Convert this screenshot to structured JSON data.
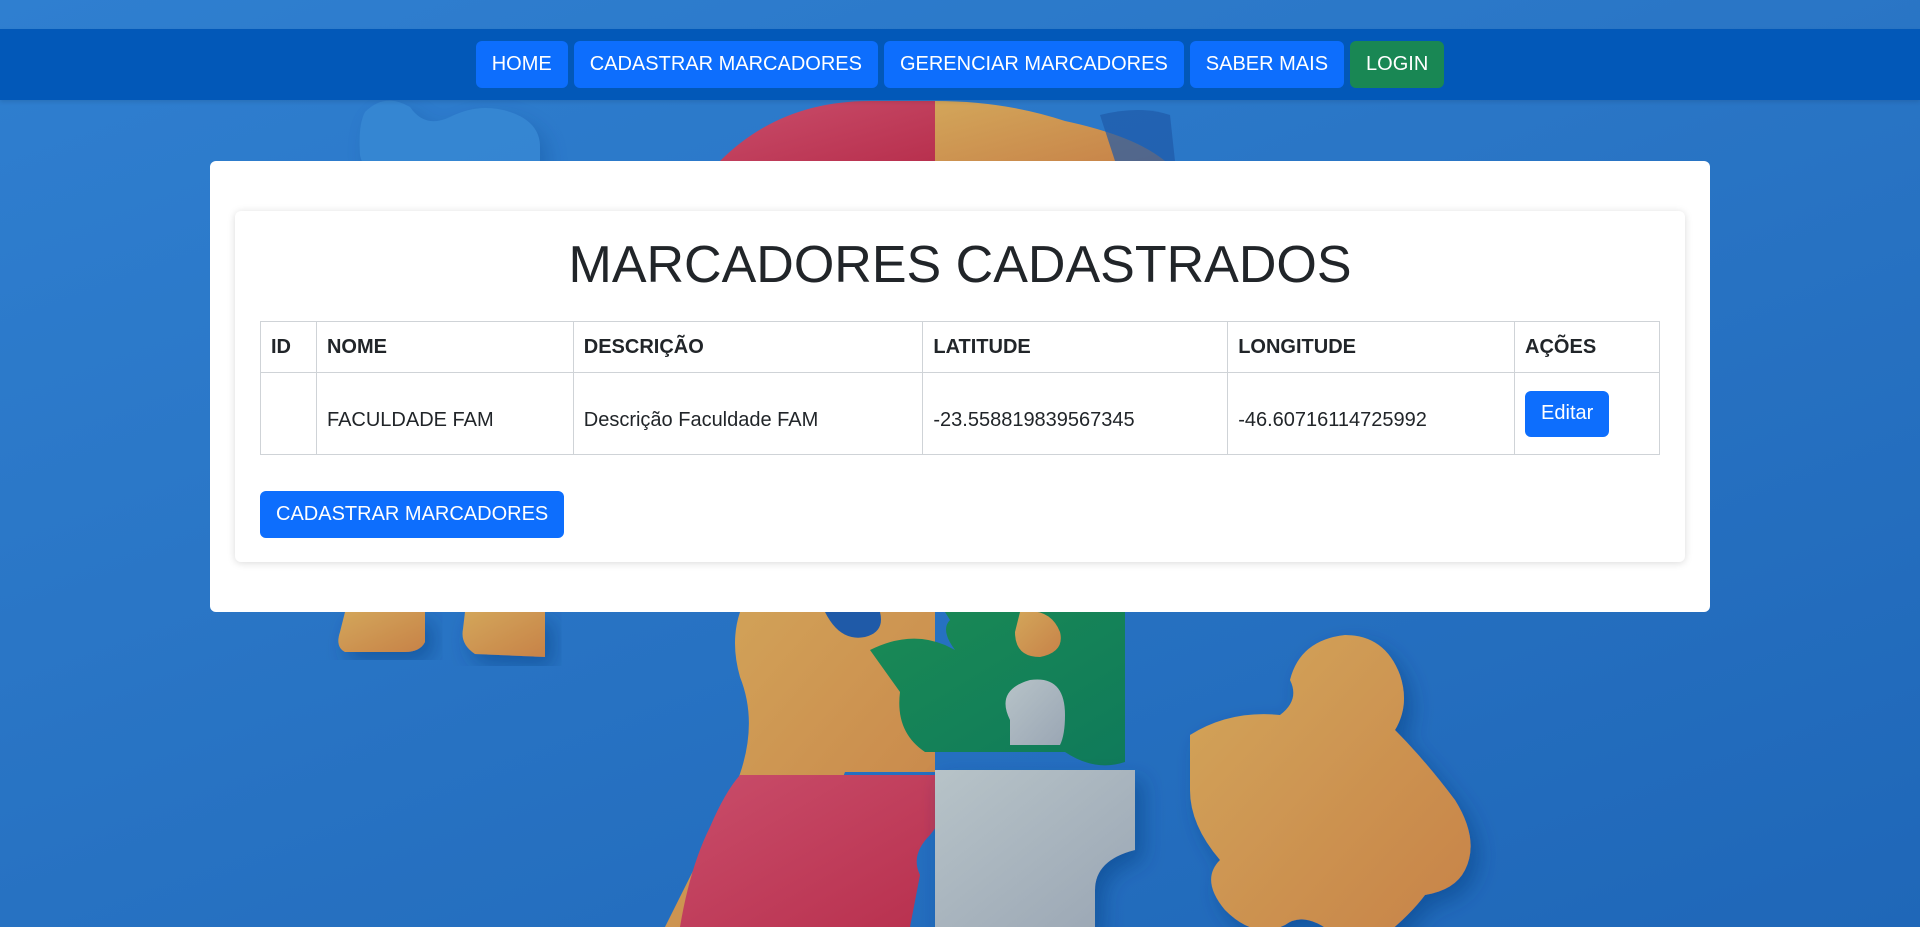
{
  "nav": {
    "items": [
      {
        "label": "HOME"
      },
      {
        "label": "CADASTRAR MARCADORES"
      },
      {
        "label": "GERENCIAR MARCADORES"
      },
      {
        "label": "SABER MAIS"
      },
      {
        "label": "LOGIN"
      }
    ]
  },
  "main": {
    "title": "MARCADORES CADASTRADOS",
    "table": {
      "headers": [
        "ID",
        "NOME",
        "DESCRIÇÃO",
        "LATITUDE",
        "LONGITUDE",
        "AÇÕES"
      ],
      "rows": [
        {
          "id": "",
          "nome": "FACULDADE FAM",
          "descricao": "Descrição Faculdade FAM",
          "latitude": "-23.558819839567345",
          "longitude": "-46.60716114725992",
          "action_label": "Editar"
        }
      ]
    },
    "register_button_label": "CADASTRAR MARCADORES"
  },
  "colors": {
    "navbar": "#0258b8",
    "primary": "#0d6efd",
    "success": "#198754",
    "background": "#2a76c6"
  }
}
